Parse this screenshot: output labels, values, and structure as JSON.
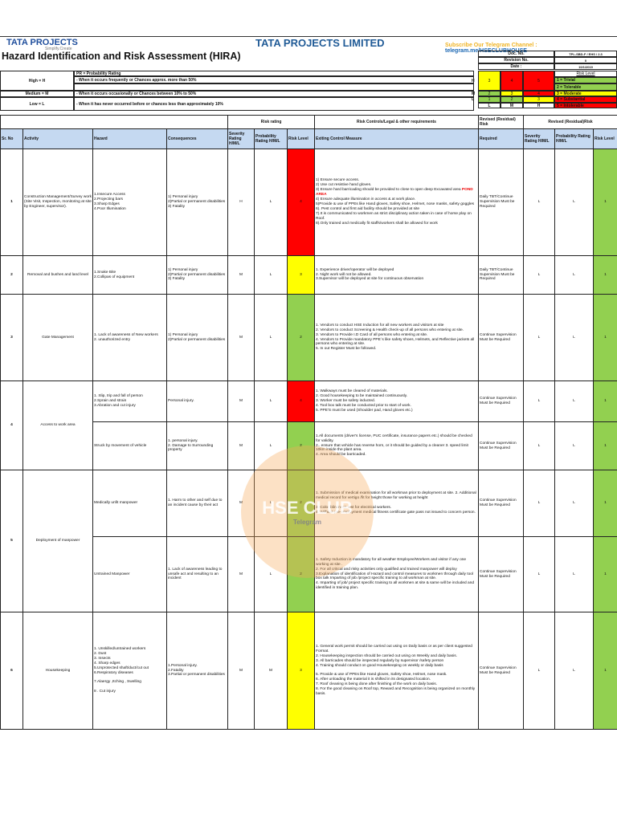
{
  "header": {
    "logo": "TATA PROJECTS",
    "logo_tagline": "Simplify.Create",
    "company": "TATA PROJECTS LIMITED",
    "telegram_prefix": "Subscribe Our Telegram Channel : ",
    "telegram_link": "telegram.me/HSECLUBHOUSE",
    "title": "Hazard Identification and Risk Assessment (HIRA)"
  },
  "doc_info": [
    {
      "label": "Doc. No.",
      "value": "TPL-SBD-F / EHS / 2.3"
    },
    {
      "label": "Revision No.",
      "value": "0"
    },
    {
      "label": "Date :",
      "value": "10/1/2019"
    }
  ],
  "probability": {
    "title": "PR = Probability Rating",
    "levels": [
      {
        "label": "High = H",
        "desc": "- When it occurs frequently or Chances approx. more than 50%"
      },
      {
        "label": "Medium = M",
        "desc": "- When it occurs occasionally or Chances between 10% to 50%"
      },
      {
        "label": "Low = L",
        "desc": "- When it has never occurred before or chances less than approximately 10%"
      }
    ]
  },
  "matrix": {
    "row_labels": [
      "H",
      "M",
      "L"
    ],
    "col_labels": [
      "L",
      "M",
      "H"
    ],
    "rows": [
      [
        "3",
        "4",
        "5"
      ],
      [
        "2",
        "3",
        "4"
      ],
      [
        "1",
        "2",
        "3"
      ]
    ],
    "colors": [
      [
        "#ffff00",
        "#ff0000",
        "#ff0000"
      ],
      [
        "#92d050",
        "#ffff00",
        "#ff0000"
      ],
      [
        "#92d050",
        "#92d050",
        "#ffff00"
      ]
    ]
  },
  "risk_legend": {
    "title": "Risk Level",
    "items": [
      {
        "text": "1 = Trivial",
        "color": "#92d050"
      },
      {
        "text": "2 = Tolerable",
        "color": "#92d050"
      },
      {
        "text": "3 = Moderate",
        "color": "#ffff00"
      },
      {
        "text": "4 = Substantial",
        "color": "#ff0000"
      },
      {
        "text": "5 = Intolerable",
        "color": "#ff0000"
      }
    ]
  },
  "groups": {
    "risk_rating": "Risk rating",
    "controls": "Risk Controls/Legal & other requirements",
    "revised_a": "Revised (Residual)  Risk",
    "revised_b": "Revised (Residual)Risk"
  },
  "columns": [
    "Sr. No",
    "Activity",
    "Hazard",
    "Consequences",
    "Severity Rating H/M/L",
    "Probability Rating H/M/L",
    "Risk Level",
    "Exiting Control Measure",
    "Required",
    "Severity Rating H/M/L",
    "Probability Rating H/M/L",
    "Risk Level"
  ],
  "rows": [
    {
      "sr": "1",
      "activity": "Construction Management/Survey work (Site Visit, Inspection, monitoring at site by Engineer, supervisor).",
      "items": [
        {
          "hazard": "1.Insecure Access\n2.Projecting bars\n3.Sharp Edges\n4.Poor Illumination",
          "consequences": "1) Personal injury\n 2)Partial or permanent disabilities\n3) Fatality",
          "sev": "H",
          "prob": "L",
          "risk": "4",
          "risk_color": "#ff0000",
          "controls": "1) Ensure secure access.\n2) Use cut resistive hand gloves.\n3) Ensure hard barricading should be provided to close to open deep Excavated area POND AREA\n4) Ensure adequate illumination in access & at work place.\n5)Provide & use of PPEs like Hand gloves, Safety shoe, Helmet, nose masks, safety goggles\n6). Pest control and first aid facility should be provided at site\n7).It is communicated to workmen as strict disciplinary action taken in case of horse play on Roof.\n                    8).Only trained and medically fit staffs/workers shall be allowed for work",
          "required": "Daily TBT/Continue Supervision Must be Required",
          "rsev": "L",
          "rprob": "L",
          "rrisk": "1",
          "h": 133
        }
      ]
    },
    {
      "sr": "2",
      "activity": "Removal and bushes and land level",
      "items": [
        {
          "hazard": "1.Snake Bite\n2.Collipas of equipment",
          "consequences": "1) Personal injury\n 2)Partial or permanent disabilities\n3) Fatality",
          "sev": "M",
          "prob": "L",
          "risk": "3",
          "risk_color": "#ffff00",
          "controls": "1. Experience driver/operator will be deployed\n          2. Night work will not be allowed.\n                    3.Supervisor will be deployed at site for continuous observation",
          "required": "Daily TBT/Continue Supervision Must be Required",
          "rsev": "L",
          "rprob": "L",
          "rrisk": "1",
          "h": 48
        }
      ]
    },
    {
      "sr": "3",
      "activity": "Gate Management",
      "items": [
        {
          "hazard": "1. Lack of awareness of New workers\n2. unauthorized entry",
          "consequences": "1) Personal injury\n 2)Partial or permanent disabilities",
          "sev": "M",
          "prob": "L",
          "risk": "2",
          "risk_color": "#92d050",
          "controls": "1. Vendors to conduct HSE Induction for all new workers and visitors at site\n2. Vendors to conduct Screening & Health check-up of all persons who entering at site.\n3. Vendors to Provide I.D Card of all persons who entering at site.\n4. Vendors to Provide mandatory PPE`s like safety shoes, Helmets, and Reflective jackets all persons who entering at site.\n5. In out Register Must be followed.",
          "required": "Continue Supervision Must be Required",
          "rsev": "L",
          "rprob": "L",
          "rrisk": "1",
          "h": 108
        }
      ]
    },
    {
      "sr": "4",
      "activity": "Access to work area",
      "items": [
        {
          "hazard": "1. Slip, trip and fall of person\n            2.Sprain and strain\n       3.Abration and cut injury",
          "consequences": "Personal injury.",
          "sev": "M",
          "prob": "L",
          "risk": "4",
          "risk_color": "#ff0000",
          "controls": "1. Walkways must be cleared of materials.\n2. Good housekeeping to be maintained continuously.\n3. Worker must be safety inducted.\n4. Tool box talk must be conducted prior to start of work.\n5. PPE'S must be used (Shoulder pad, Hand gloves etc.)",
          "required": "Continue Supervision Must be Required",
          "rsev": "L",
          "rprob": "L",
          "rrisk": "1",
          "h": 51
        },
        {
          "hazard": "Struck by movement of vehicle",
          "consequences": "1. personal injury.\n2. Damage to Surrounding property",
          "sev": "M",
          "prob": "L",
          "risk": "2",
          "risk_color": "#92d050",
          "controls": "1.All documents (driver's license, PUC certificate, insurance papers etc.) should be checked for validity.\n2.. ensure that vehicle has reverse horn, or it should be guided by a cleaner 3. speed limit 10km inside the plant area.\n4. Area should be barricaded.",
          "required": "Continue Supervision Must be Required",
          "rsev": "L",
          "rprob": "L",
          "rrisk": "1",
          "h": 60
        }
      ]
    },
    {
      "sr": "5",
      "activity": "Deployment of manpower",
      "items": [
        {
          "hazard": "Medically unfit manpower",
          "consequences": "1. Harm to other and self due to an incident cause by their act",
          "sev": "M",
          "prob": "L",
          "risk": "2",
          "risk_color": "#92d050",
          "controls": "1. Submission of medical examination for all workman prior to deployment at site.  2. Additional medical record for vertigo /fit for height those for working at height\n\n3. Color blindness test for electrical workers.\n4. Without pre-employment medical fitness certificate gate pass not issued to concern person.",
          "required": "Continue Supervision Must be Required",
          "rsev": "L",
          "rprob": "L",
          "rrisk": "1",
          "h": 83
        },
        {
          "hazard": "Untrained Manpower",
          "consequences": "1. Lack of awareness leading to unsafe act and resulting to an incident",
          "sev": "M",
          "prob": "L",
          "risk": "2",
          "risk_color": "#92d050",
          "controls": "1. Safety Induction is mandatory for all weather Employee/Workers and visitor if any one working at site .\n2. For all critical and risky activities only qualified and trained manpower will deploy\n3.Explanation of identification of Hazard and control measures to workmen through daily tool box talk Imparting of job /project specific training to all workman at site.\n4. Imparting of job/ project specific training to all workmen at site & same will be included and identified in training plan.",
          "required": "Continue Supervision Must be Required",
          "rsev": "L",
          "rprob": "L",
          "rrisk": "1",
          "h": 94
        }
      ]
    },
    {
      "sr": "6",
      "activity": "Housekeeping",
      "items": [
        {
          "hazard": "1. Unskilled/untrained workers\n2. Dust\n3. Insects\n4. Sharp edges\n5.Unprotected shaft/duct/cut out\n6.Respiratory diseases\n\n7.Alaergy ,Itching , Swelling\n\n8 . Cut injury",
          "consequences": "1.Personal injury.\n2.Fatality\n3.Partial or permanent disabilities",
          "sev": "M",
          "prob": "M",
          "risk": "3",
          "risk_color": "#ffff00",
          "controls": "1. General work permit should be carried out using on Daily basis or as per client suggested Format.\n2. Housekeeping inspection should be carried out using on Weekly and daily basis.\n           3. All barricades should be inspected regularly by supervisor /safety person\n                     4. Training should conduct on good Housekeeping on weekly or daily basis\n\n                                 5. Provide & use of PPEs like Hand gloves, Safety shoe, Helmet, nose mask.\n6. After unloading the material it is shifted in its designated location.\n7. Roof cleaning is being done after finishing of the work on daily basis.\n8. For the good cleaning on Roof top, Reward and Recognition is being organized on monthly basis.",
          "required": "Continue Supervision Must be Required",
          "rsev": "L",
          "rprob": "L",
          "rrisk": "1",
          "h": 146
        }
      ]
    }
  ],
  "watermark": {
    "text": "HSE CLUB",
    "sub": "Telegram"
  }
}
